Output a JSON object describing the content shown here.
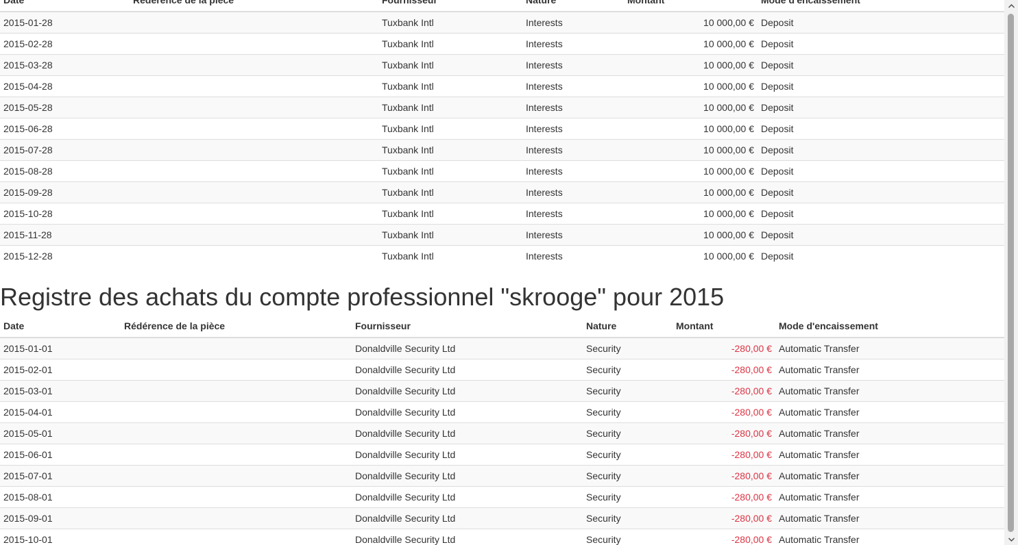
{
  "colors": {
    "negative_amount": "#dc3545",
    "row_stripe": "#f9f9f9",
    "border": "#dddddd",
    "text": "#333333",
    "scrollbar_thumb": "#a8a8a8"
  },
  "sales_table": {
    "headers": {
      "date": "Date",
      "reference": "Rédérence de la pièce",
      "supplier": "Fournisseur",
      "nature": "Nature",
      "amount": "Montant",
      "payment_mode": "Mode d'encaissement"
    },
    "rows": [
      {
        "date": "2015-01-28",
        "reference": "",
        "supplier": "Tuxbank Intl",
        "nature": "Interests",
        "amount": "10 000,00 €",
        "payment_mode": "Deposit"
      },
      {
        "date": "2015-02-28",
        "reference": "",
        "supplier": "Tuxbank Intl",
        "nature": "Interests",
        "amount": "10 000,00 €",
        "payment_mode": "Deposit"
      },
      {
        "date": "2015-03-28",
        "reference": "",
        "supplier": "Tuxbank Intl",
        "nature": "Interests",
        "amount": "10 000,00 €",
        "payment_mode": "Deposit"
      },
      {
        "date": "2015-04-28",
        "reference": "",
        "supplier": "Tuxbank Intl",
        "nature": "Interests",
        "amount": "10 000,00 €",
        "payment_mode": "Deposit"
      },
      {
        "date": "2015-05-28",
        "reference": "",
        "supplier": "Tuxbank Intl",
        "nature": "Interests",
        "amount": "10 000,00 €",
        "payment_mode": "Deposit"
      },
      {
        "date": "2015-06-28",
        "reference": "",
        "supplier": "Tuxbank Intl",
        "nature": "Interests",
        "amount": "10 000,00 €",
        "payment_mode": "Deposit"
      },
      {
        "date": "2015-07-28",
        "reference": "",
        "supplier": "Tuxbank Intl",
        "nature": "Interests",
        "amount": "10 000,00 €",
        "payment_mode": "Deposit"
      },
      {
        "date": "2015-08-28",
        "reference": "",
        "supplier": "Tuxbank Intl",
        "nature": "Interests",
        "amount": "10 000,00 €",
        "payment_mode": "Deposit"
      },
      {
        "date": "2015-09-28",
        "reference": "",
        "supplier": "Tuxbank Intl",
        "nature": "Interests",
        "amount": "10 000,00 €",
        "payment_mode": "Deposit"
      },
      {
        "date": "2015-10-28",
        "reference": "",
        "supplier": "Tuxbank Intl",
        "nature": "Interests",
        "amount": "10 000,00 €",
        "payment_mode": "Deposit"
      },
      {
        "date": "2015-11-28",
        "reference": "",
        "supplier": "Tuxbank Intl",
        "nature": "Interests",
        "amount": "10 000,00 €",
        "payment_mode": "Deposit"
      },
      {
        "date": "2015-12-28",
        "reference": "",
        "supplier": "Tuxbank Intl",
        "nature": "Interests",
        "amount": "10 000,00 €",
        "payment_mode": "Deposit"
      }
    ]
  },
  "purchases_section": {
    "title": "Registre des achats du compte professionnel \"skrooge\" pour 2015"
  },
  "purchases_table": {
    "headers": {
      "date": "Date",
      "reference": "Rédérence de la pièce",
      "supplier": "Fournisseur",
      "nature": "Nature",
      "amount": "Montant",
      "payment_mode": "Mode d'encaissement"
    },
    "rows": [
      {
        "date": "2015-01-01",
        "reference": "",
        "supplier": "Donaldville Security Ltd",
        "nature": "Security",
        "amount": "-280,00 €",
        "payment_mode": "Automatic Transfer"
      },
      {
        "date": "2015-02-01",
        "reference": "",
        "supplier": "Donaldville Security Ltd",
        "nature": "Security",
        "amount": "-280,00 €",
        "payment_mode": "Automatic Transfer"
      },
      {
        "date": "2015-03-01",
        "reference": "",
        "supplier": "Donaldville Security Ltd",
        "nature": "Security",
        "amount": "-280,00 €",
        "payment_mode": "Automatic Transfer"
      },
      {
        "date": "2015-04-01",
        "reference": "",
        "supplier": "Donaldville Security Ltd",
        "nature": "Security",
        "amount": "-280,00 €",
        "payment_mode": "Automatic Transfer"
      },
      {
        "date": "2015-05-01",
        "reference": "",
        "supplier": "Donaldville Security Ltd",
        "nature": "Security",
        "amount": "-280,00 €",
        "payment_mode": "Automatic Transfer"
      },
      {
        "date": "2015-06-01",
        "reference": "",
        "supplier": "Donaldville Security Ltd",
        "nature": "Security",
        "amount": "-280,00 €",
        "payment_mode": "Automatic Transfer"
      },
      {
        "date": "2015-07-01",
        "reference": "",
        "supplier": "Donaldville Security Ltd",
        "nature": "Security",
        "amount": "-280,00 €",
        "payment_mode": "Automatic Transfer"
      },
      {
        "date": "2015-08-01",
        "reference": "",
        "supplier": "Donaldville Security Ltd",
        "nature": "Security",
        "amount": "-280,00 €",
        "payment_mode": "Automatic Transfer"
      },
      {
        "date": "2015-09-01",
        "reference": "",
        "supplier": "Donaldville Security Ltd",
        "nature": "Security",
        "amount": "-280,00 €",
        "payment_mode": "Automatic Transfer"
      },
      {
        "date": "2015-10-01",
        "reference": "",
        "supplier": "Donaldville Security Ltd",
        "nature": "Security",
        "amount": "-280,00 €",
        "payment_mode": "Automatic Transfer"
      }
    ]
  },
  "scrollbar": {
    "up_icon": "chevron-up-icon",
    "down_icon": "chevron-down-icon"
  }
}
